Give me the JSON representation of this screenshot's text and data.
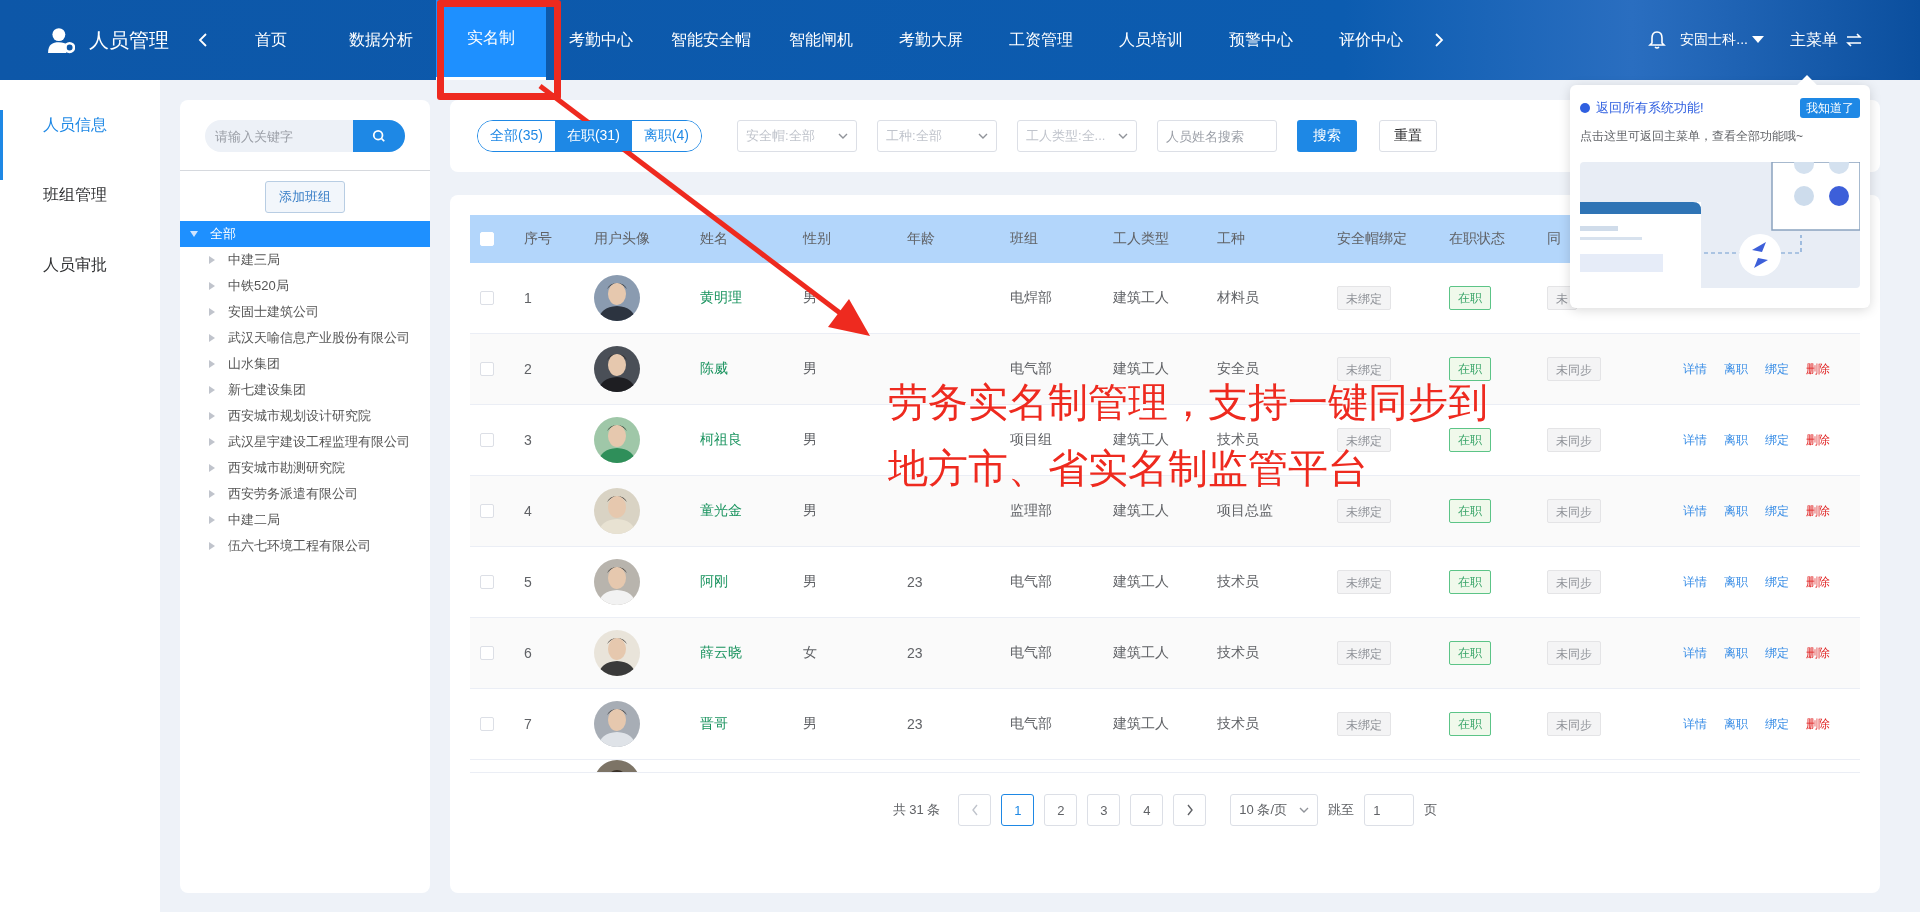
{
  "app": {
    "title": "人员管理"
  },
  "nav": [
    {
      "label": "首页",
      "selected": false
    },
    {
      "label": "数据分析",
      "selected": false
    },
    {
      "label": "实名制",
      "selected": true
    },
    {
      "label": "考勤中心",
      "selected": false
    },
    {
      "label": "智能安全帽",
      "selected": false
    },
    {
      "label": "智能闸机",
      "selected": false
    },
    {
      "label": "考勤大屏",
      "selected": false
    },
    {
      "label": "工资管理",
      "selected": false
    },
    {
      "label": "人员培训",
      "selected": false
    },
    {
      "label": "预警中心",
      "selected": false
    },
    {
      "label": "评价中心",
      "selected": false
    }
  ],
  "user": {
    "name": "安固士科..."
  },
  "main_menu": {
    "label": "主菜单"
  },
  "sidebar": [
    {
      "label": "人员信息",
      "selected": true
    },
    {
      "label": "班组管理",
      "selected": false
    },
    {
      "label": "人员审批",
      "selected": false
    }
  ],
  "tree": {
    "search_placeholder": "请输入关键字",
    "add_button": "添加班组",
    "root": {
      "label": "全部",
      "selected": true,
      "expanded": true,
      "children": [
        {
          "label": "中建三局",
          "expanded": false
        },
        {
          "label": "中铁520局",
          "expanded": false
        },
        {
          "label": "安固士建筑公司",
          "expanded": false
        },
        {
          "label": "武汉天喻信息产业股份有限公司",
          "expanded": false
        },
        {
          "label": "山水集团",
          "expanded": false
        },
        {
          "label": "新七建设集团",
          "expanded": false
        },
        {
          "label": "西安城市规划设计研究院",
          "expanded": false
        },
        {
          "label": "武汉星宇建设工程监理有限公司",
          "expanded": false
        },
        {
          "label": "西安城市勘测研究院",
          "expanded": false
        },
        {
          "label": "西安劳务派遣有限公司",
          "expanded": false
        },
        {
          "label": "中建二局",
          "expanded": false
        },
        {
          "label": "伍六七环境工程有限公司",
          "expanded": false
        }
      ]
    }
  },
  "filters": {
    "status_tabs": [
      {
        "label": "全部(35)",
        "selected": false
      },
      {
        "label": "在职(31)",
        "selected": true
      },
      {
        "label": "离职(4)",
        "selected": false
      }
    ],
    "selects": [
      {
        "placeholder": "安全帽:全部"
      },
      {
        "placeholder": "工种:全部"
      },
      {
        "placeholder": "工人类型:全..."
      }
    ],
    "name_search": {
      "placeholder": "人员姓名搜索"
    },
    "search_button": "搜索",
    "reset_button": "重置"
  },
  "table": {
    "header_checked": false,
    "columns": [
      "序号",
      "用户头像",
      "姓名",
      "性别",
      "年龄",
      "班组",
      "工人类型",
      "工种",
      "安全帽绑定",
      "在职状态",
      "同"
    ],
    "rows": [
      {
        "checked": false,
        "no": "1",
        "name": "黄明理",
        "gender": "男",
        "team": "电焊部",
        "worker_type": "建筑工人",
        "job": "材料员",
        "helmet": "未绑定",
        "status": "在职",
        "sync": "未"
      },
      {
        "checked": false,
        "no": "2",
        "name": "陈威",
        "gender": "男",
        "team": "电气部",
        "worker_type": "建筑工人",
        "job": "安全员",
        "helmet": "未绑定",
        "status": "在职",
        "sync": "未同步",
        "actions": [
          {
            "label": "详情",
            "kind": "link"
          },
          {
            "label": "离职",
            "kind": "link"
          },
          {
            "label": "绑定",
            "kind": "link"
          },
          {
            "label": "删除",
            "kind": "danger"
          }
        ]
      },
      {
        "checked": false,
        "no": "3",
        "name": "柯祖良",
        "gender": "男",
        "team": "项目组",
        "worker_type": "建筑工人",
        "job": "技术员",
        "helmet": "未绑定",
        "status": "在职",
        "sync": "未同步",
        "actions": [
          {
            "label": "详情",
            "kind": "link"
          },
          {
            "label": "离职",
            "kind": "link"
          },
          {
            "label": "绑定",
            "kind": "link"
          },
          {
            "label": "删除",
            "kind": "danger"
          }
        ]
      },
      {
        "checked": false,
        "no": "4",
        "name": "童光金",
        "gender": "男",
        "team": "监理部",
        "worker_type": "建筑工人",
        "job": "项目总监",
        "helmet": "未绑定",
        "status": "在职",
        "sync": "未同步",
        "actions": [
          {
            "label": "详情",
            "kind": "link"
          },
          {
            "label": "离职",
            "kind": "link"
          },
          {
            "label": "绑定",
            "kind": "link"
          },
          {
            "label": "删除",
            "kind": "danger"
          }
        ]
      },
      {
        "checked": false,
        "no": "5",
        "name": "阿刚",
        "gender": "男",
        "age": "23",
        "team": "电气部",
        "worker_type": "建筑工人",
        "job": "技术员",
        "helmet": "未绑定",
        "status": "在职",
        "sync": "未同步",
        "actions": [
          {
            "label": "详情",
            "kind": "link"
          },
          {
            "label": "离职",
            "kind": "link"
          },
          {
            "label": "绑定",
            "kind": "link"
          },
          {
            "label": "删除",
            "kind": "danger"
          }
        ]
      },
      {
        "checked": false,
        "no": "6",
        "name": "薛云晓",
        "gender": "女",
        "age": "23",
        "team": "电气部",
        "worker_type": "建筑工人",
        "job": "技术员",
        "helmet": "未绑定",
        "status": "在职",
        "sync": "未同步",
        "actions": [
          {
            "label": "详情",
            "kind": "link"
          },
          {
            "label": "离职",
            "kind": "link"
          },
          {
            "label": "绑定",
            "kind": "link"
          },
          {
            "label": "删除",
            "kind": "danger"
          }
        ]
      },
      {
        "checked": false,
        "no": "7",
        "name": "晋哥",
        "gender": "男",
        "age": "23",
        "team": "电气部",
        "worker_type": "建筑工人",
        "job": "技术员",
        "helmet": "未绑定",
        "status": "在职",
        "sync": "未同步",
        "actions": [
          {
            "label": "详情",
            "kind": "link"
          },
          {
            "label": "离职",
            "kind": "link"
          },
          {
            "label": "绑定",
            "kind": "link"
          },
          {
            "label": "删除",
            "kind": "danger"
          }
        ]
      }
    ]
  },
  "pagination": {
    "total": "共 31 条",
    "pages": [
      {
        "label": "1",
        "selected": true
      },
      {
        "label": "2",
        "selected": false
      },
      {
        "label": "3",
        "selected": false
      },
      {
        "label": "4",
        "selected": false
      }
    ],
    "page_size": "10 条/页",
    "jump_label": "跳至",
    "jump_value": "1",
    "page_suffix": "页"
  },
  "popup": {
    "title": "返回所有系统功能!",
    "button": "我知道了",
    "text": "点击这里可返回主菜单，查看全部功能哦~"
  },
  "annotation": {
    "lines": [
      "劳务实名制管理，支持一键同步到",
      "地方市、省实名制监管平台"
    ]
  }
}
